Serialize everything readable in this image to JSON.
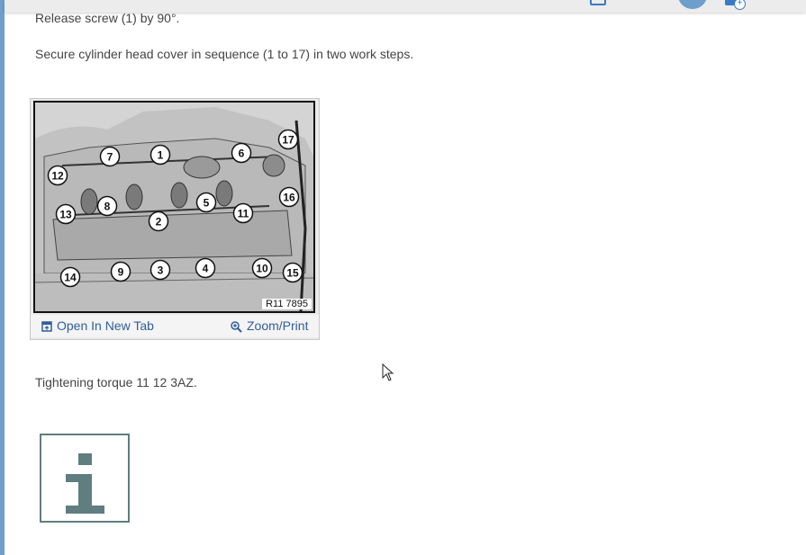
{
  "instructions": {
    "release": "Release screw (1) by 90°.",
    "secure": "Secure cylinder head cover in sequence (1 to 17) in two work steps.",
    "torque": "Tightening torque 11 12 3AZ."
  },
  "figure": {
    "reference": "R11 7895",
    "callouts": [
      "1",
      "2",
      "3",
      "4",
      "5",
      "6",
      "7",
      "8",
      "9",
      "10",
      "11",
      "12",
      "13",
      "14",
      "15",
      "16",
      "17"
    ],
    "open_label": "Open In New Tab",
    "zoom_label": "Zoom/Print"
  },
  "icons": {
    "info": "info-icon",
    "open": "open-in-new-tab-icon",
    "zoom": "zoom-icon",
    "cursor": "mouse-cursor-icon"
  },
  "colors": {
    "link": "#2f5e9c",
    "info_icon": "#607d80",
    "accent": "#6e9ecb"
  }
}
